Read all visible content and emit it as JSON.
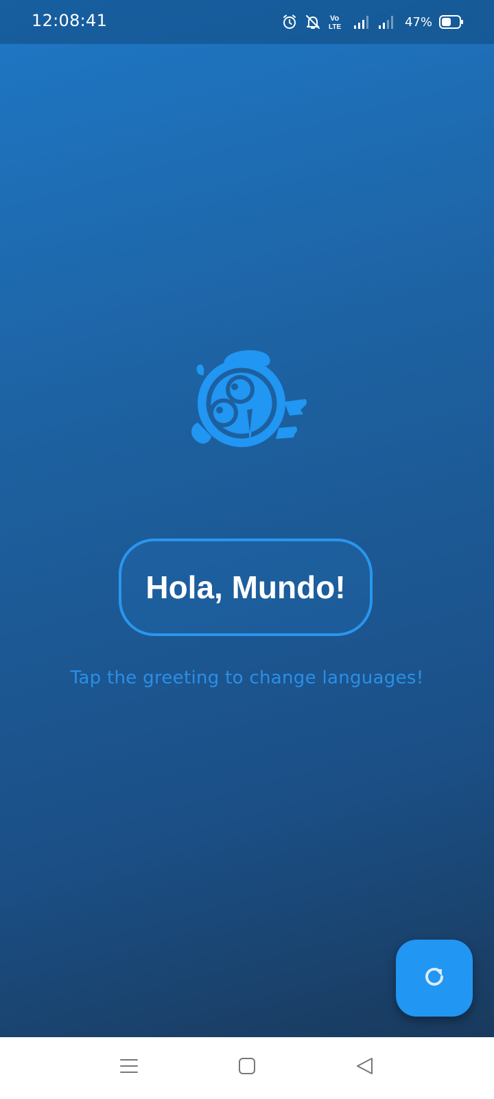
{
  "status_bar": {
    "time": "12:08:41",
    "battery_percent": "47%",
    "icons": [
      "alarm-icon",
      "notifications-off-icon",
      "volte-icon",
      "signal-icon",
      "signal-icon",
      "battery-icon"
    ],
    "volte_top": "Vo",
    "volte_bottom": "LTE"
  },
  "main": {
    "logo_icon": "kiwi-bird-logo-icon",
    "greeting": "Hola, Mundo!",
    "hint": "Tap the greeting to change languages!"
  },
  "fab": {
    "icon": "refresh-icon"
  },
  "nav_bar": {
    "icons": [
      "menu-icon",
      "home-icon",
      "back-icon"
    ]
  },
  "colors": {
    "accent": "#2196f3",
    "background_top": "#1f78c6",
    "background_bottom": "#193a5d",
    "hint_text": "#2b8fe6"
  }
}
